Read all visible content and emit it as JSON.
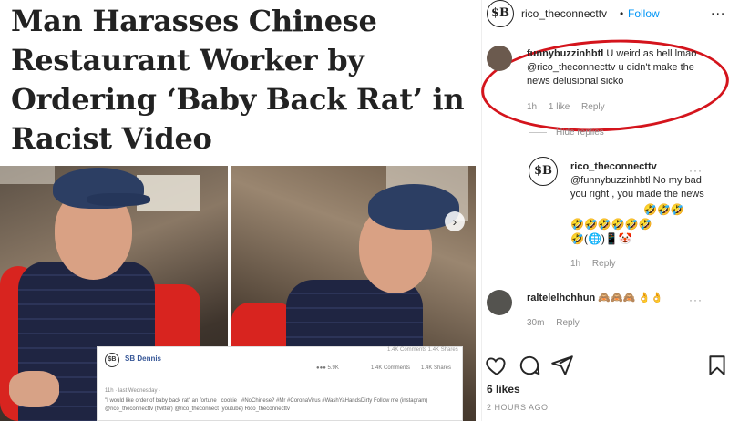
{
  "article": {
    "headline_lines": [
      "Man Harasses Chinese",
      "Restaurant Worker by",
      "Ordering ‘Baby Back Rat’ in",
      "Racist Video"
    ],
    "fb_post": {
      "logo": "$B",
      "name": "SB Dennis",
      "top_stats": "1.4K  Comments     1.4K  Shares",
      "reacts": "●●● 5.9K",
      "comments": "1.4K Comments",
      "shares": "1.4K Shares",
      "meta": "11h · last Wednesday ·",
      "body": "\"I would like order of baby back rat\" an fortune   cookie   #NoChinese? #Mr #CoronaVirus #WashYaHandsDirty Follow me (instagram) @rico_theconnecttv (twitter) @rico_theconnect (youtube) Rico_theconnecttv"
    }
  },
  "instagram": {
    "header": {
      "avatar_text": "$B",
      "username": "rico_theconnecttv",
      "dot": "•",
      "follow_label": "Follow",
      "more": "..."
    },
    "comments": [
      {
        "username": "funnybuzzinhbtl",
        "text": "U weird as hell lmao @rico_theconnecttv u didn't make the news delusional sicko",
        "time": "1h",
        "likes": "1 like",
        "reply": "Reply"
      }
    ],
    "hide_replies": "Hide replies",
    "reply": {
      "avatar_text": "$B",
      "username": "rico_theconnecttv",
      "text": "@funnybuzzinhbtl No my bad you right , you made the news",
      "emoji_line_1": "🤣🤣🤣",
      "emoji_line_2": "🤣🤣🤣🤣🤣🤣",
      "emoji_line_3": "🤣(🌐)📱🤡",
      "time": "1h",
      "reply_label": "Reply"
    },
    "comment2": {
      "username": "raltelelhchhun",
      "emojis": "🙈🙈🙈 👌👌",
      "time": "30m",
      "reply_label": "Reply"
    },
    "likes": "6 likes",
    "time_ago": "2 HOURS AGO"
  },
  "colors": {
    "follow": "#0095f6",
    "annotation_circle": "#d4141c",
    "muted": "#8e8e8e"
  }
}
